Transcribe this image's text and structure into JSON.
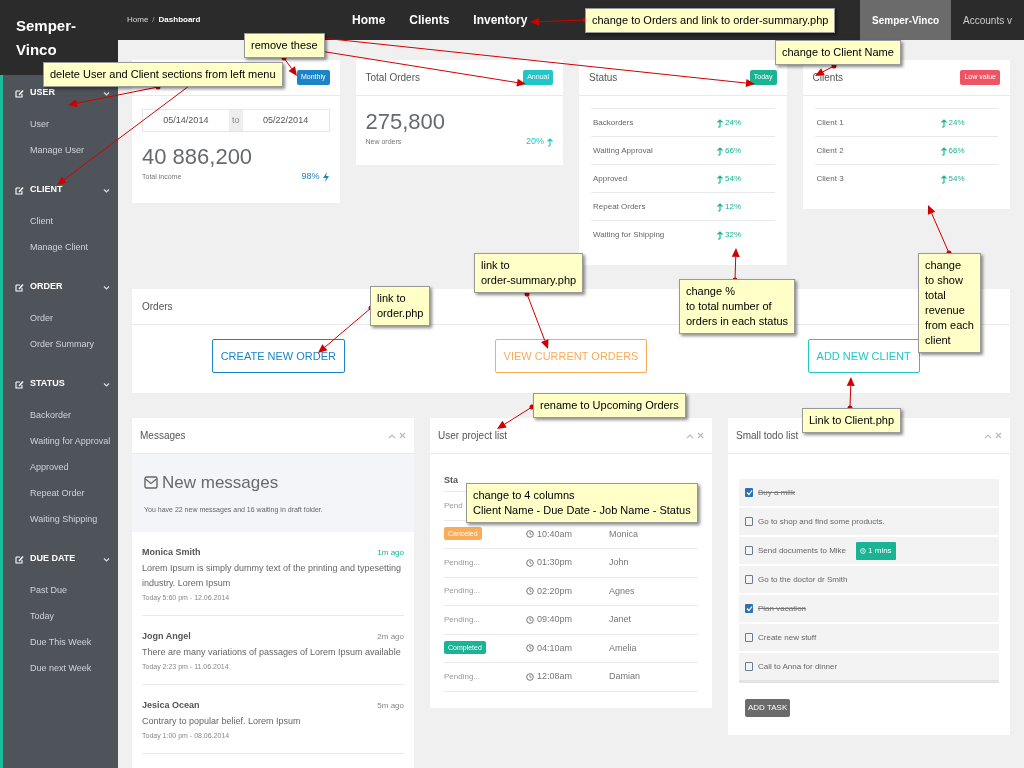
{
  "brand": "Semper-Vinco",
  "breadcrumb_separator": "/",
  "breadcrumb": [
    {
      "label": "Home",
      "current": false
    },
    {
      "label": "Dashboard",
      "current": true
    }
  ],
  "nav": [
    {
      "label": "Home",
      "selected": false
    },
    {
      "label": "Clients",
      "selected": false
    },
    {
      "label": "Inventory",
      "selected": false
    },
    {
      "label": "Semper-Vinco",
      "selected": true
    },
    {
      "label": "Accounts v",
      "selected": false
    }
  ],
  "sidebar": [
    {
      "title": "USER",
      "items": [
        "User",
        "Manage User"
      ]
    },
    {
      "title": "CLIENT",
      "items": [
        "Client",
        "Manage Client"
      ]
    },
    {
      "title": "ORDER",
      "items": [
        "Order",
        "Order Summary"
      ]
    },
    {
      "title": "STATUS",
      "items": [
        "Backorder",
        "Waiting for Approval",
        "Approved",
        "Repeat Order",
        "Waiting Shipping"
      ]
    },
    {
      "title": "DUE DATE",
      "items": [
        "Past Due",
        "Today",
        "Due This Week",
        "Due next Week"
      ]
    }
  ],
  "cards": [
    {
      "kind": "income",
      "badge": "Monthly",
      "color": "#1c84c6",
      "date_from": "05/14/2014",
      "date_sep": "to",
      "date_to": "05/22/2014",
      "value": "40 886,200",
      "caption": "Total income",
      "change": "98%"
    },
    {
      "kind": "total",
      "title": "Total Orders",
      "badge": "Annual",
      "color": "#23c6c8",
      "value": "275,800",
      "caption": "New orders",
      "change": "20%"
    },
    {
      "kind": "list",
      "title": "Status",
      "badge": "Today",
      "color": "#1ab394",
      "rows": [
        {
          "label": "Backorders",
          "value": "24%"
        },
        {
          "label": "Waiting Approval",
          "value": "66%"
        },
        {
          "label": "Approved",
          "value": "54%"
        },
        {
          "label": "Repeat Orders",
          "value": "12%"
        },
        {
          "label": "Waiting for Shipping",
          "value": "32%"
        }
      ]
    },
    {
      "kind": "list",
      "title": "Clients",
      "badge": "Low value",
      "color": "#ed5565",
      "rows": [
        {
          "label": "Client 1",
          "value": "24%"
        },
        {
          "label": "Client 2",
          "value": "66%"
        },
        {
          "label": "Client 3",
          "value": "54%"
        }
      ]
    }
  ],
  "orders": {
    "title": "Orders",
    "buttons": [
      {
        "label": "CREATE NEW ORDER",
        "color": "#1c84c6"
      },
      {
        "label": "VIEW CURRENT ORDERS",
        "color": "#f8ac59"
      },
      {
        "label": "ADD NEW CLIENT",
        "color": "#23c6c8"
      }
    ]
  },
  "messages": {
    "title": "Messages",
    "heading": "New messages",
    "summary": "You have 22 new messages and 16 waiting in draft folder.",
    "items": [
      {
        "name": "Monica Smith",
        "ago": "1m ago",
        "recent": true,
        "text": "Lorem Ipsum is simply dummy text of the printing and typesetting industry. Lorem Ipsum",
        "date": "Today 5:60 pm - 12.06.2014"
      },
      {
        "name": "Jogn Angel",
        "ago": "2m ago",
        "recent": false,
        "text": "There are many variations of passages of Lorem Ipsum available",
        "date": "Today 2:23 pm - 11.06.2014"
      },
      {
        "name": "Jesica Ocean",
        "ago": "5m ago",
        "recent": false,
        "text": "Contrary to popular belief. Lorem Ipsum",
        "date": "Today 1:00 pm - 08.06.2014"
      }
    ]
  },
  "projects": {
    "title": "User project list",
    "columns": [
      "Sta"
    ],
    "rows": [
      {
        "status": {
          "kind": "text",
          "text": "Pend"
        }
      },
      {
        "status": {
          "kind": "label",
          "text": "Canceled",
          "color": "#f8ac59"
        },
        "time": "10:40am",
        "name": "Monica"
      },
      {
        "status": {
          "kind": "text",
          "text": "Pending..."
        },
        "time": "01:30pm",
        "name": "John"
      },
      {
        "status": {
          "kind": "text",
          "text": "Pending..."
        },
        "time": "02:20pm",
        "name": "Agnes"
      },
      {
        "status": {
          "kind": "text",
          "text": "Pending..."
        },
        "time": "09:40pm",
        "name": "Janet"
      },
      {
        "status": {
          "kind": "label",
          "text": "Completed",
          "color": "#1ab394"
        },
        "time": "04:10am",
        "name": "Amelia"
      },
      {
        "status": {
          "kind": "text",
          "text": "Pending..."
        },
        "time": "12:08am",
        "name": "Damian"
      }
    ]
  },
  "todo": {
    "title": "Small todo list",
    "button": "ADD TASK",
    "items": [
      {
        "text": "Buy a milk",
        "checked": true
      },
      {
        "text": "Go to shop and find some products.",
        "checked": false
      },
      {
        "text": "Send documents to Mike",
        "checked": false,
        "badge": "1 mins"
      },
      {
        "text": "Go to the doctor dr Smith",
        "checked": false
      },
      {
        "text": "Plan vacation",
        "checked": true
      },
      {
        "text": "Create new stuff",
        "checked": false
      },
      {
        "text": "Call to Anna for dinner",
        "checked": false
      }
    ]
  },
  "annotations": [
    "change to Orders and link to order-summary.php",
    "remove these",
    "delete User and Client sections from left menu",
    "change to Client Name",
    "link to\norder-summary.php",
    "link to\norder.php",
    "change %\nto total number of\norders in each status",
    "change\nto show\ntotal\nrevenue\nfrom each\nclient",
    "rename to Upcoming Orders",
    "Link to Client.php",
    "change to 4 columns\nClient Name - Due Date - Job Name - Status"
  ]
}
